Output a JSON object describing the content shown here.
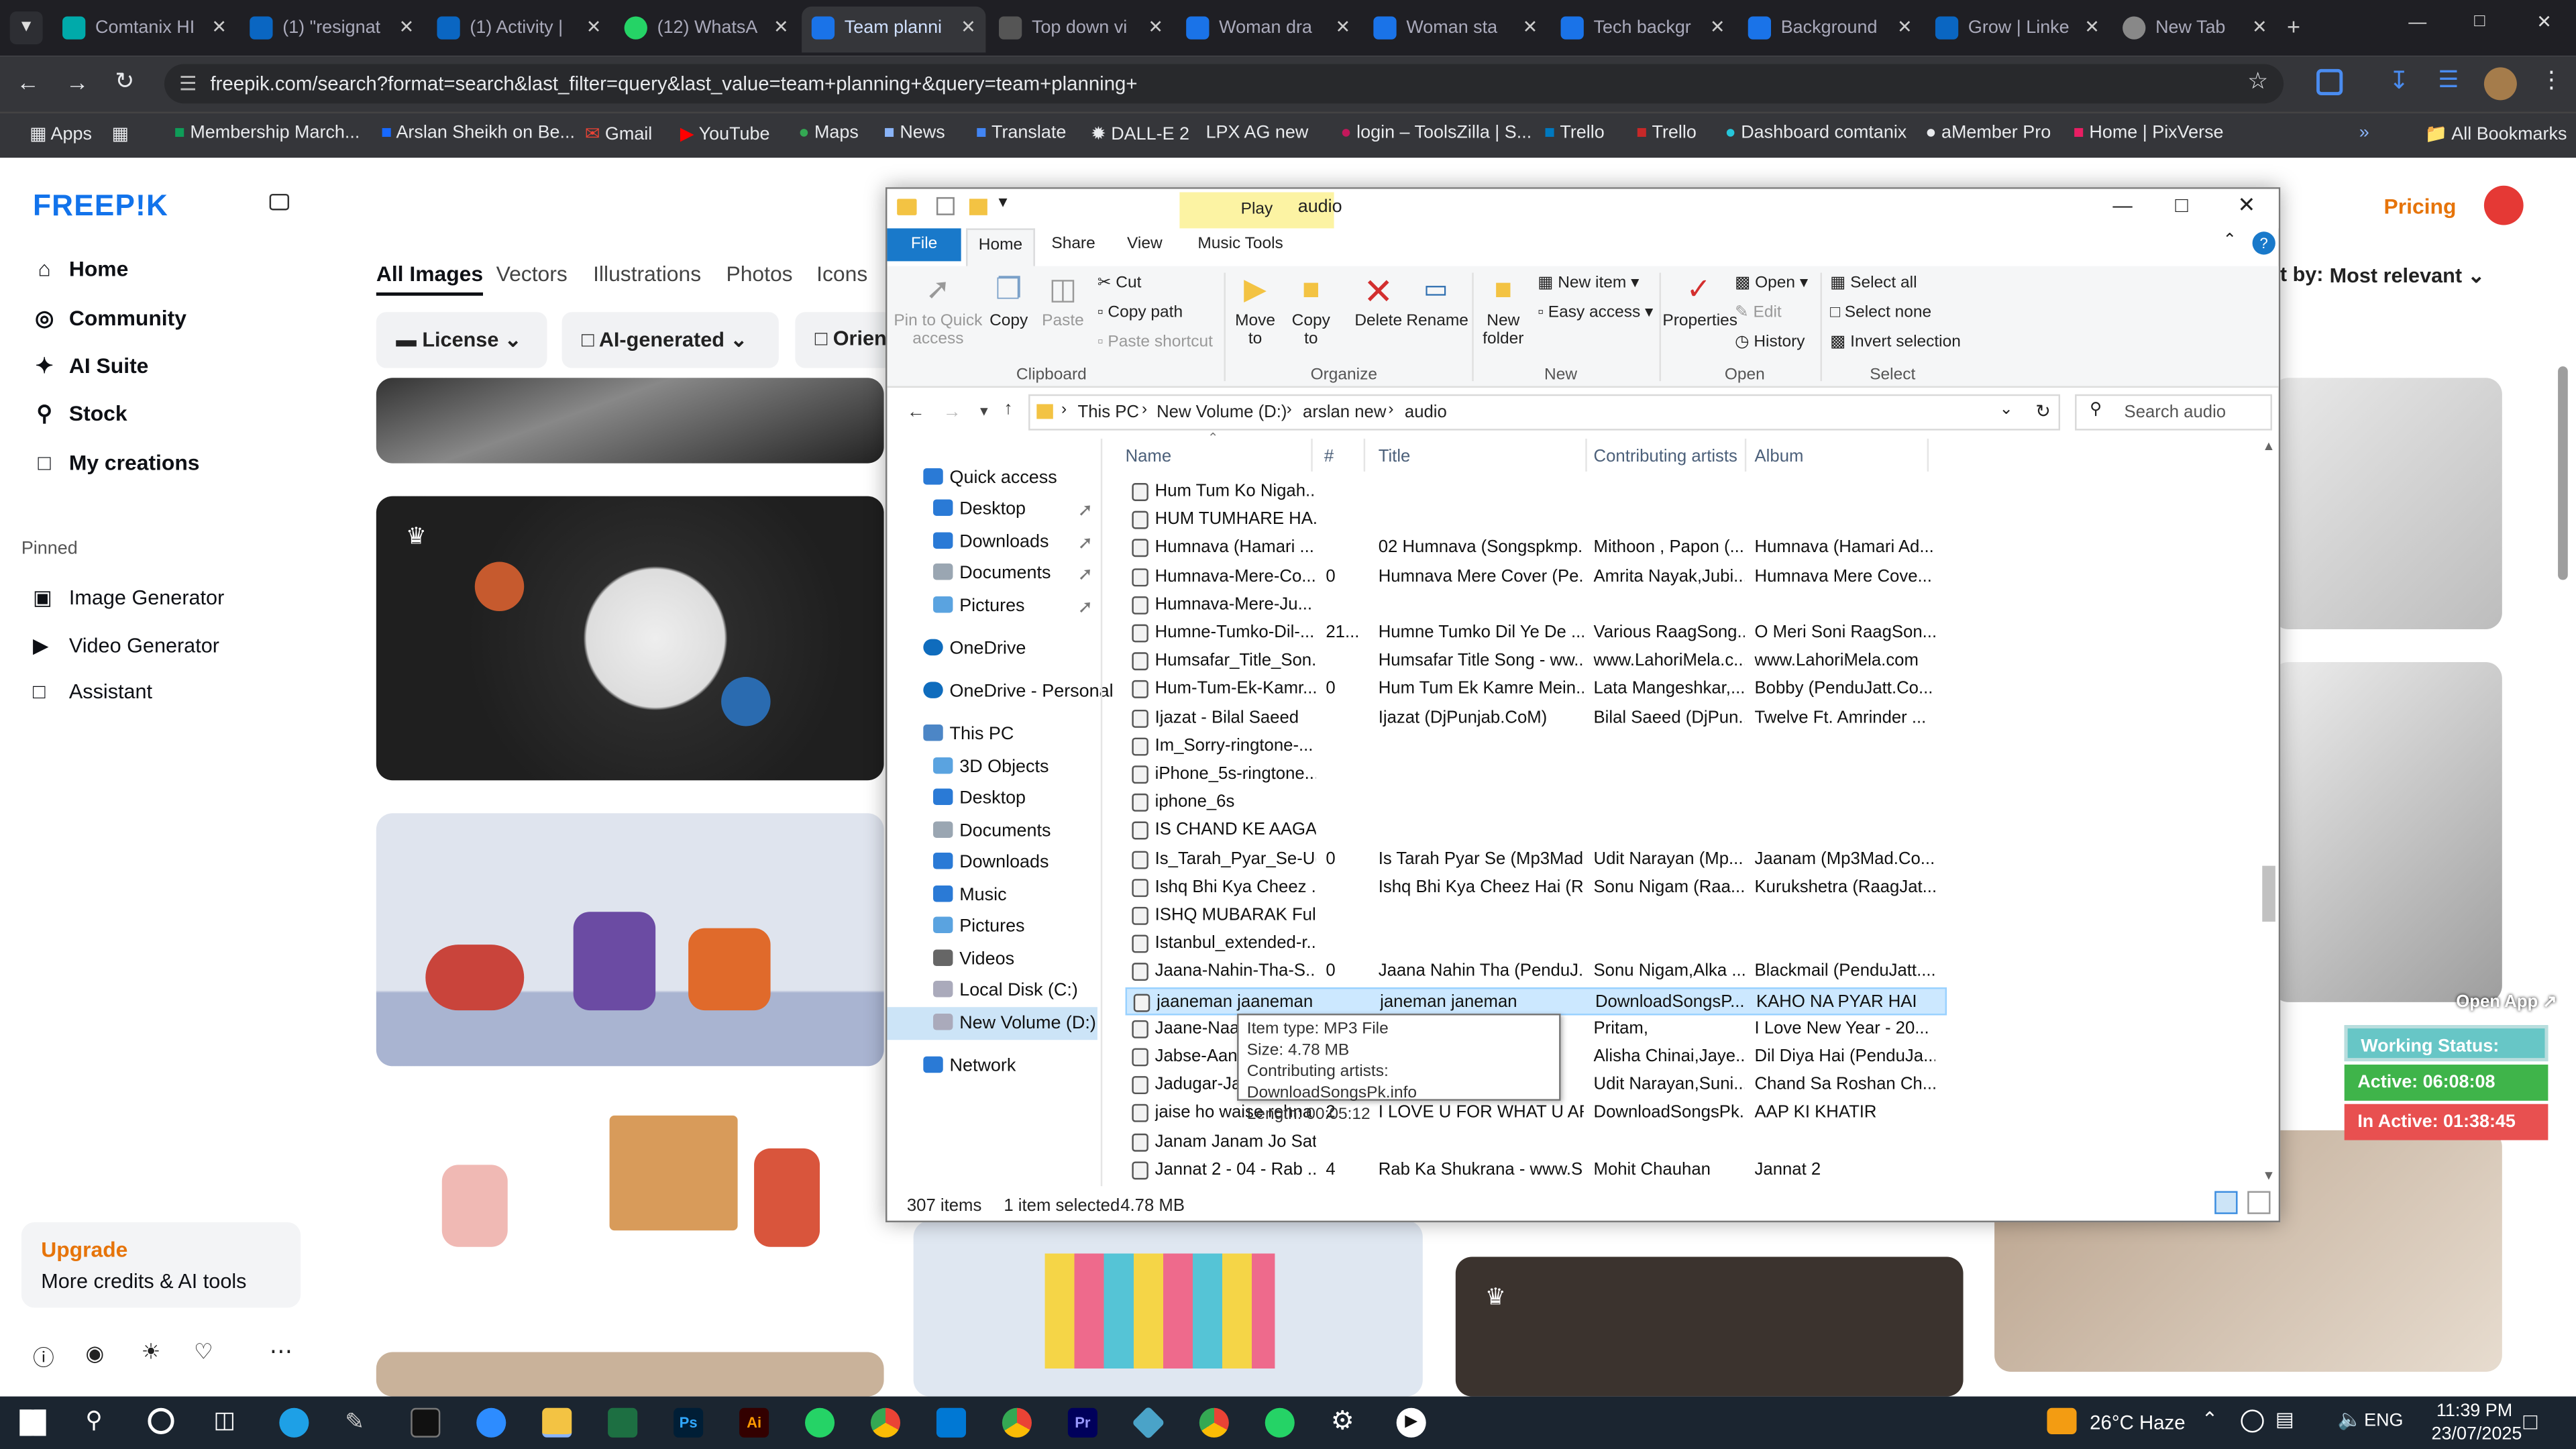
{
  "browser": {
    "tabs": [
      "Comtanix HI",
      "(1) \"resignat",
      "(1) Activity |",
      "(12) WhatsA",
      "Team planni",
      "Top down vi",
      "Woman dra",
      "Woman sta",
      "Tech backgr",
      "Background",
      "Grow | Linke",
      "New Tab"
    ],
    "url": "freepik.com/search?format=search&last_filter=query&last_value=team+planning+&query=team+planning+",
    "bookmarks": [
      "Apps",
      "Membership March...",
      "Arslan Sheikh on Be...",
      "Gmail",
      "YouTube",
      "Maps",
      "News",
      "Translate",
      "DALL-E 2",
      "LPX AG new",
      "login – ToolsZilla | S...",
      "Trello",
      "Trello",
      "Dashboard comtanix",
      "aMember Pro",
      "Home | PixVerse"
    ],
    "all_bookmarks": "All Bookmarks"
  },
  "freepik": {
    "logo": "FREEP!K",
    "nav": [
      "Home",
      "Community",
      "AI Suite",
      "Stock",
      "My creations"
    ],
    "pinned_label": "Pinned",
    "pinned": [
      "Image Generator",
      "Video Generator",
      "Assistant"
    ],
    "upgrade_title": "Upgrade",
    "upgrade_sub": "More credits & AI tools",
    "tabs": [
      "All Images",
      "Vectors",
      "Illustrations",
      "Photos",
      "Icons"
    ],
    "filters": [
      "License",
      "AI-generated",
      "Orien"
    ],
    "pricing": "Pricing",
    "sort_label": "rt by:",
    "sort_value": "Most relevant"
  },
  "explorer": {
    "title": "audio",
    "context_tab": "Play",
    "tabs": [
      "File",
      "Home",
      "Share",
      "View",
      "Music Tools"
    ],
    "ribbon": {
      "pin": "Pin to Quick access",
      "copy": "Copy",
      "paste": "Paste",
      "cut": "Cut",
      "copy_path": "Copy path",
      "paste_shortcut": "Paste shortcut",
      "move_to": "Move to",
      "copy_to": "Copy to",
      "delete": "Delete",
      "rename": "Rename",
      "new_folder": "New folder",
      "new_item": "New item",
      "easy_access": "Easy access",
      "properties": "Properties",
      "open": "Open",
      "edit": "Edit",
      "history": "History",
      "select_all": "Select all",
      "select_none": "Select none",
      "invert_selection": "Invert selection",
      "groups": [
        "Clipboard",
        "Organize",
        "New",
        "Open",
        "Select"
      ]
    },
    "breadcrumb": [
      "This PC",
      "New Volume (D:)",
      "arslan new",
      "audio"
    ],
    "search_placeholder": "Search audio",
    "nav_pane": [
      "Quick access",
      "Desktop",
      "Downloads",
      "Documents",
      "Pictures",
      "OneDrive",
      "OneDrive - Personal",
      "This PC",
      "3D Objects",
      "Desktop",
      "Documents",
      "Downloads",
      "Music",
      "Pictures",
      "Videos",
      "Local Disk (C:)",
      "New Volume (D:)",
      "Network"
    ],
    "columns": [
      "Name",
      "#",
      "Title",
      "Contributing artists",
      "Album"
    ],
    "files": [
      {
        "name": "Hum Tum Ko Nigah...",
        "num": "",
        "title": "",
        "artist": "",
        "album": ""
      },
      {
        "name": "HUM TUMHARE HA...",
        "num": "",
        "title": "",
        "artist": "",
        "album": ""
      },
      {
        "name": "Humnava (Hamari ...",
        "num": "",
        "title": "02 Humnava (Songspkmp...",
        "artist": "Mithoon , Papon (...",
        "album": "Humnava (Hamari Ad..."
      },
      {
        "name": "Humnava-Mere-Co...",
        "num": "0",
        "title": "Humnava Mere Cover (Pe...",
        "artist": "Amrita Nayak,Jubi...",
        "album": "Humnava Mere Cove..."
      },
      {
        "name": "Humnava-Mere-Ju...",
        "num": "",
        "title": "",
        "artist": "",
        "album": ""
      },
      {
        "name": "Humne-Tumko-Dil-...",
        "num": "21...",
        "title": "Humne Tumko Dil Ye De ...",
        "artist": "Various RaagSong...",
        "album": "O Meri Soni RaagSon..."
      },
      {
        "name": "Humsafar_Title_Son...",
        "num": "",
        "title": "Humsafar Title Song - ww...",
        "artist": "www.LahoriMela.c...",
        "album": "www.LahoriMela.com"
      },
      {
        "name": "Hum-Tum-Ek-Kamr...",
        "num": "0",
        "title": "Hum Tum Ek Kamre Mein...",
        "artist": "Lata Mangeshkar,...",
        "album": "Bobby (PenduJatt.Co..."
      },
      {
        "name": "Ijazat - Bilal Saeed",
        "num": "",
        "title": "Ijazat (DjPunjab.CoM)",
        "artist": "Bilal Saeed (DjPun...",
        "album": "Twelve Ft. Amrinder ..."
      },
      {
        "name": "Im_Sorry-ringtone-...",
        "num": "",
        "title": "",
        "artist": "",
        "album": ""
      },
      {
        "name": "iPhone_5s-ringtone...",
        "num": "",
        "title": "",
        "artist": "",
        "album": ""
      },
      {
        "name": "iphone_6s",
        "num": "",
        "title": "",
        "artist": "",
        "album": ""
      },
      {
        "name": "IS CHAND KE AAGAY",
        "num": "",
        "title": "",
        "artist": "",
        "album": ""
      },
      {
        "name": "Is_Tarah_Pyar_Se-Ud...",
        "num": "0",
        "title": "Is Tarah Pyar Se (Mp3Mad...",
        "artist": "Udit Narayan (Mp...",
        "album": "Jaanam (Mp3Mad.Co..."
      },
      {
        "name": "Ishq Bhi Kya Cheez ...",
        "num": "",
        "title": "Ishq Bhi Kya Cheez Hai (R...",
        "artist": "Sonu Nigam (Raa...",
        "album": "Kurukshetra (RaagJat..."
      },
      {
        "name": "ISHQ MUBARAK Ful...",
        "num": "",
        "title": "",
        "artist": "",
        "album": ""
      },
      {
        "name": "Istanbul_extended-r...",
        "num": "",
        "title": "",
        "artist": "",
        "album": ""
      },
      {
        "name": "Jaana-Nahin-Tha-S...",
        "num": "0",
        "title": "Jaana Nahin Tha (PenduJ...",
        "artist": "Sonu Nigam,Alka ...",
        "album": "Blackmail (PenduJatt...."
      },
      {
        "name": "jaaneman jaaneman",
        "num": "",
        "title": "janeman janeman",
        "artist": "DownloadSongsP...",
        "album": "KAHO NA PYAR HAI"
      },
      {
        "name": "Jaane-Naa-K",
        "num": "",
        "title": "",
        "artist": "Pritam,",
        "album": "I Love New Year - 20..."
      },
      {
        "name": "Jabse-Aankh",
        "num": "",
        "title": "",
        "artist": "Alisha Chinai,Jaye...",
        "album": "Dil Diya Hai (PenduJa..."
      },
      {
        "name": "Jadugar-Jadu",
        "num": "",
        "title": "",
        "artist": "Udit Narayan,Suni...",
        "album": "Chand Sa Roshan Ch..."
      },
      {
        "name": "jaise ho waise rehna",
        "num": "2",
        "title": "I LOVE U FOR WHAT U ARE",
        "artist": "DownloadSongsPk...",
        "album": "AAP KI KHATIR"
      },
      {
        "name": "Janam Janam Jo Sath",
        "num": "",
        "title": "",
        "artist": "",
        "album": ""
      },
      {
        "name": "Jannat 2 - 04 - Rab ...",
        "num": "4",
        "title": "Rab Ka Shukrana - www.S...",
        "artist": "Mohit Chauhan",
        "album": "Jannat 2"
      }
    ],
    "tooltip": [
      "Item type: MP3 File",
      "Size: 4.78 MB",
      "Contributing artists: DownloadSongsPk.info",
      "Length: 00:05:12"
    ],
    "status_items": "307 items",
    "status_selected": "1 item selected",
    "status_size": "4.78 MB"
  },
  "widget": {
    "open_app": "Open App ↗",
    "working": "Working Status: Active",
    "active": "Active: 06:08:08",
    "inactive": "In Active: 01:38:45"
  },
  "taskbar": {
    "weather": "26°C Haze",
    "lang": "ENG",
    "time": "11:39 PM",
    "date": "23/07/2025"
  }
}
